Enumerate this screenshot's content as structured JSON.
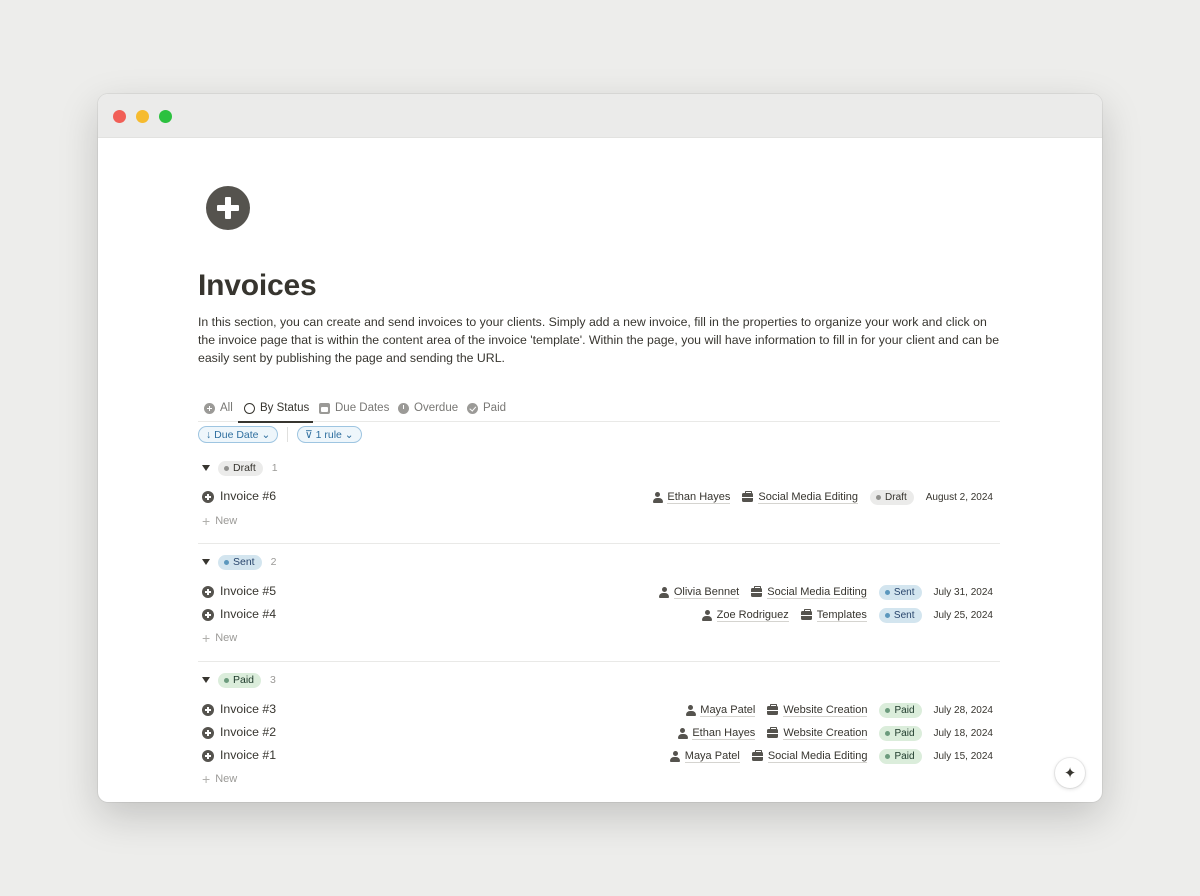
{
  "page": {
    "title": "Invoices",
    "description": "In this section, you can create and send invoices to your clients. Simply add a new invoice, fill in the properties to organize your work and click on the invoice page that is within the content area of the invoice 'template'. Within the page, you will have information to fill in for your client and can be easily sent by publishing the page and sending the URL."
  },
  "tabs": [
    {
      "label": "All",
      "icon": "plus-circle-icon"
    },
    {
      "label": "By Status",
      "icon": "status-icon"
    },
    {
      "label": "Due Dates",
      "icon": "calendar-icon"
    },
    {
      "label": "Overdue",
      "icon": "alert-icon"
    },
    {
      "label": "Paid",
      "icon": "check-circle-icon"
    }
  ],
  "filters": {
    "sort_label": "↓ Due Date ⌄",
    "rule_label": "⊽ 1 rule ⌄"
  },
  "new_label": "New",
  "groups": [
    {
      "status": "Draft",
      "count": "1",
      "rows": [
        {
          "name": "Invoice #6",
          "client": "Ethan Hayes",
          "project": "Social Media Editing",
          "status": "Draft",
          "date": "August 2, 2024"
        }
      ]
    },
    {
      "status": "Sent",
      "count": "2",
      "rows": [
        {
          "name": "Invoice #5",
          "client": "Olivia Bennet",
          "project": "Social Media Editing",
          "status": "Sent",
          "date": "July 31, 2024"
        },
        {
          "name": "Invoice #4",
          "client": "Zoe Rodriguez",
          "project": "Templates",
          "status": "Sent",
          "date": "July 25, 2024"
        }
      ]
    },
    {
      "status": "Paid",
      "count": "3",
      "rows": [
        {
          "name": "Invoice #3",
          "client": "Maya Patel",
          "project": "Website Creation",
          "status": "Paid",
          "date": "July 28, 2024"
        },
        {
          "name": "Invoice #2",
          "client": "Ethan Hayes",
          "project": "Website Creation",
          "status": "Paid",
          "date": "July 18, 2024"
        },
        {
          "name": "Invoice #1",
          "client": "Maya Patel",
          "project": "Social Media Editing",
          "status": "Paid",
          "date": "July 15, 2024"
        }
      ]
    }
  ],
  "colors": {
    "draft": "#ebebea",
    "sent": "#d3e5ef",
    "paid": "#dbeddb",
    "accent": "#2f6f9f"
  }
}
